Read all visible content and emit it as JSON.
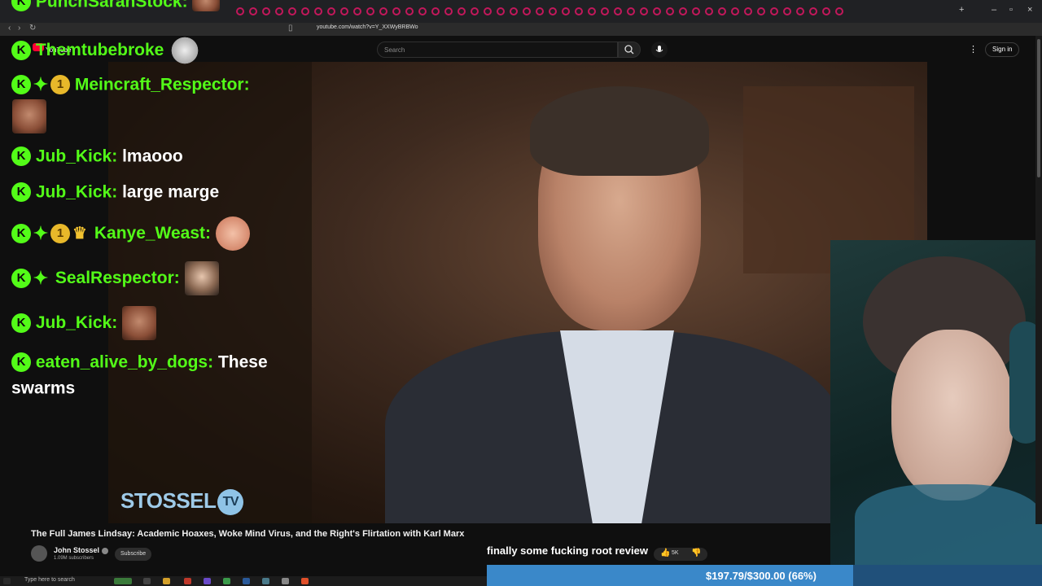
{
  "browser": {
    "url": "youtube.com/watch?v=Y_XXWyBRBWo"
  },
  "youtube": {
    "logo_text": "YouTube",
    "search_placeholder": "Search",
    "signin_label": "Sign in",
    "video_title": "The Full James Lindsay: Academic Hoaxes, Woke Mind Virus, and the Right's Flirtation with Karl Marx",
    "channel_name": "John Stossel",
    "subscribers": "1.09M subscribers",
    "subscribe_label": "Subscribe",
    "like_count": "5K"
  },
  "video": {
    "watermark": "STOSSEL",
    "watermark_tv": "TV"
  },
  "chat": {
    "messages": [
      {
        "user": "PunchSarahStock:",
        "text": ""
      },
      {
        "user": "Themtubebroke",
        "text": ""
      },
      {
        "user": "Meincraft_Respector:",
        "text": ""
      },
      {
        "user": "Jub_Kick:",
        "text": "lmaooo"
      },
      {
        "user": "Jub_Kick:",
        "text": "large marge"
      },
      {
        "user": "Kanye_Weast:",
        "text": ""
      },
      {
        "user": "SealRespector:",
        "text": ""
      },
      {
        "user": "Jub_Kick:",
        "text": ""
      },
      {
        "user": "eaten_alive_by_dogs:",
        "text": "These",
        "text2": "swarms"
      }
    ],
    "colors": {
      "username": "#53fc18",
      "message": "#ffffff"
    }
  },
  "stream": {
    "title": "finally some fucking root review",
    "goal_text": "$197.79/$300.00 (66%)",
    "goal_fraction": 0.66
  },
  "taskbar": {
    "search_placeholder": "Type here to search"
  }
}
